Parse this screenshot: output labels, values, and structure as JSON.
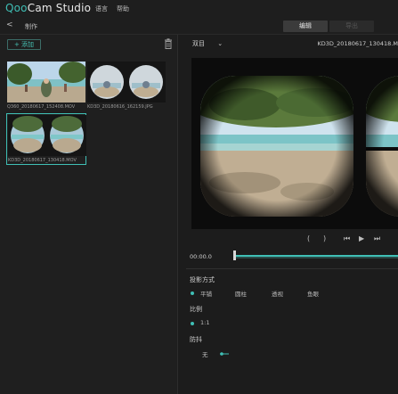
{
  "app": {
    "logo_prefix": "Qoo",
    "logo_suffix": "Cam Studio",
    "menu": [
      "语言",
      "帮助"
    ]
  },
  "toolbar": {
    "back_label": "<",
    "breadcrumb": "制作",
    "tabs": [
      {
        "label": "编辑",
        "active": true
      },
      {
        "label": "导出",
        "active": false
      }
    ]
  },
  "library": {
    "add_label": "+ 添加",
    "items": [
      {
        "caption": "Q360_20180617_152408.MOV",
        "kind": "panorama",
        "selected": false
      },
      {
        "caption": "KD3D_20180616_162159.JPG",
        "kind": "stereo",
        "selected": false
      },
      {
        "caption": "KD3D_20180617_130418.MOV",
        "kind": "stereo",
        "selected": true
      }
    ]
  },
  "preview": {
    "view_mode": "双目",
    "filename": "KD3D_20180617_130418.M"
  },
  "playback": {
    "buttons": [
      "(",
      ")",
      "⏮",
      "▶",
      "⏭"
    ],
    "time": "00:00.0",
    "progress": 0.0
  },
  "settings": {
    "projection_label": "投影方式",
    "projection_options": [
      "平铺",
      "圆柱",
      "透视",
      "鱼眼"
    ],
    "projection_selected": "平铺",
    "ratio_label": "比例",
    "ratio_value": "1:1",
    "stabilize_label": "防抖",
    "stabilize_value": "无"
  },
  "colors": {
    "accent": "#3fbfb5",
    "panel": "#1f1f1f",
    "background": "#1c1c1c"
  }
}
